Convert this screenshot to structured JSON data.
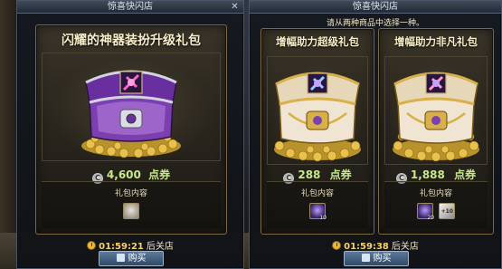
{
  "left_window": {
    "title": "惊喜快闪店",
    "gift": {
      "name": "闪耀的神器装扮升级礼包",
      "price": "4,600",
      "currency": "点券",
      "contents_label": "礼包内容",
      "items": [
        {
          "icon": "box-scroll-icon",
          "badge": ""
        }
      ]
    },
    "timer": "01:59:21",
    "timer_suffix": "后关店",
    "buy_label": "购买"
  },
  "right_window": {
    "title": "惊喜快闪店",
    "subtitle": "请从两种商品中选择一种。",
    "gifts": [
      {
        "name": "增幅助力超级礼包",
        "price": "288",
        "currency": "点券",
        "contents_label": "礼包内容",
        "items": [
          {
            "icon": "amplify-orb-icon",
            "badge": "10"
          }
        ]
      },
      {
        "name": "增幅助力非凡礼包",
        "price": "1,888",
        "currency": "点券",
        "contents_label": "礼包内容",
        "items": [
          {
            "icon": "amplify-orb-icon",
            "badge": "20"
          },
          {
            "icon": "plus-buff-icon",
            "badge": "+10"
          }
        ]
      }
    ],
    "timer": "01:59:38",
    "timer_suffix": "后关店",
    "buy_label": "购买"
  },
  "colors": {
    "price_green": "#c7e88a",
    "timer_gold": "#f4d26a",
    "title_cream": "#f6edc8",
    "chest_purple": "#7b3fb0",
    "chest_gold": "#d8b04a"
  }
}
